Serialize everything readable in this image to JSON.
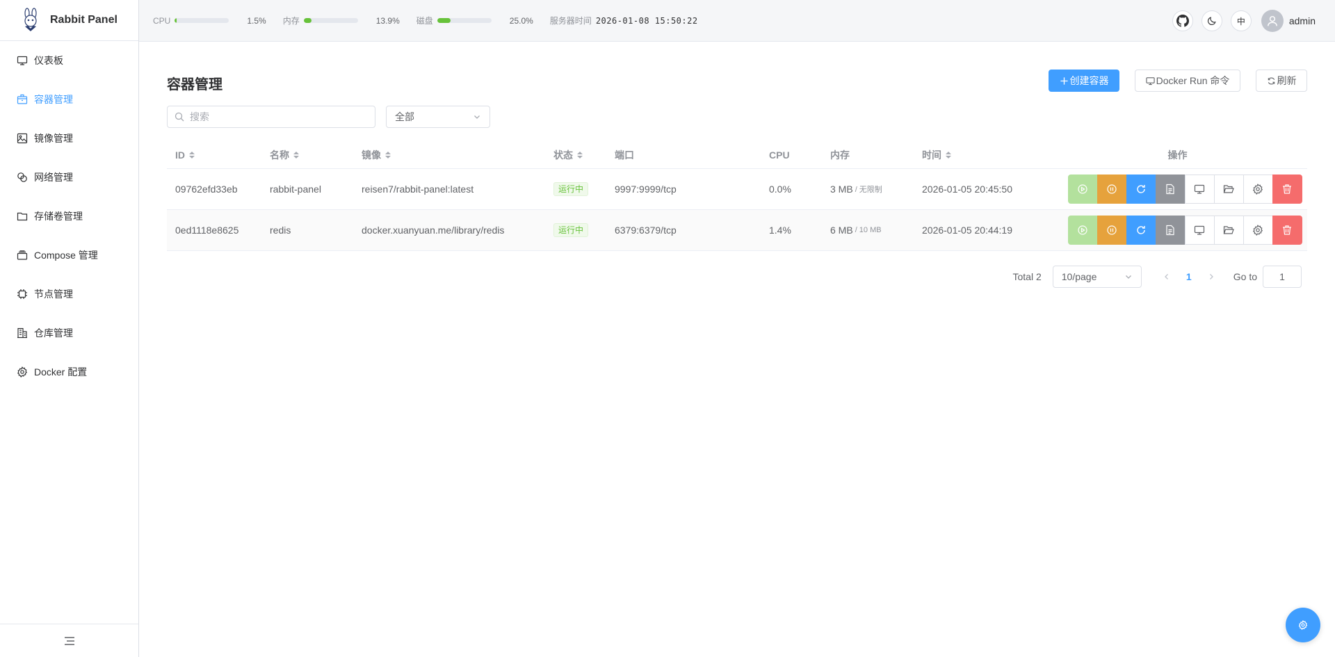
{
  "brand": {
    "name": "Rabbit Panel",
    "logo_icon": "rabbit-logo"
  },
  "sidebar": {
    "items": [
      {
        "label": "仪表板",
        "icon": "monitor-icon",
        "active": false
      },
      {
        "label": "容器管理",
        "icon": "box-icon",
        "active": true
      },
      {
        "label": "镜像管理",
        "icon": "image-icon",
        "active": false
      },
      {
        "label": "网络管理",
        "icon": "network-icon",
        "active": false
      },
      {
        "label": "存储卷管理",
        "icon": "folder-icon",
        "active": false
      },
      {
        "label": "Compose 管理",
        "icon": "stack-icon",
        "active": false
      },
      {
        "label": "节点管理",
        "icon": "cpu-icon",
        "active": false
      },
      {
        "label": "仓库管理",
        "icon": "building-icon",
        "active": false
      },
      {
        "label": "Docker 配置",
        "icon": "gear-icon",
        "active": false
      }
    ],
    "collapse_icon": "menu-collapse-icon"
  },
  "header": {
    "cpu": {
      "label": "CPU",
      "value": "1.5%",
      "fraction": 0.015
    },
    "mem": {
      "label": "内存",
      "value": "13.9%",
      "fraction": 0.139
    },
    "disk": {
      "label": "磁盘",
      "value": "25.0%",
      "fraction": 0.25
    },
    "server_time_label": "服务器时间",
    "server_time": "2026-01-08 15:50:22",
    "lang_label": "中",
    "username": "admin",
    "bar_color": "#67c23a"
  },
  "main": {
    "title": "容器管理",
    "create_label": "创建容器",
    "docker_run_label": "Docker Run 命令",
    "refresh_label": "刷新",
    "search_placeholder": "搜索",
    "filter_value": "全部",
    "columns": {
      "id": "ID",
      "name": "名称",
      "image": "镜像",
      "status": "状态",
      "port": "端口",
      "cpu": "CPU",
      "mem": "内存",
      "time": "时间",
      "ops": "操作"
    },
    "rows": [
      {
        "id": "09762efd33eb",
        "name": "rabbit-panel",
        "image": "reisen7/rabbit-panel:latest",
        "status": "运行中",
        "port": "9997:9999/tcp",
        "cpu": "0.0%",
        "mem": "3 MB",
        "mem_limit": "/ 无限制",
        "time": "2026-01-05 20:45:50"
      },
      {
        "id": "0ed1118e8625",
        "name": "redis",
        "image": "docker.xuanyuan.me/library/redis",
        "status": "运行中",
        "port": "6379:6379/tcp",
        "cpu": "1.4%",
        "mem": "6 MB",
        "mem_limit": "/ 10 MB",
        "time": "2026-01-05 20:44:19"
      }
    ]
  },
  "pagination": {
    "total": "Total 2",
    "page_size": "10/page",
    "current": "1",
    "goto_label": "Go to",
    "goto_value": "1"
  },
  "colors": {
    "primary": "#409eff",
    "success": "#67c23a",
    "warning": "#e6a23c",
    "danger": "#f56c6c",
    "info": "#909399"
  }
}
